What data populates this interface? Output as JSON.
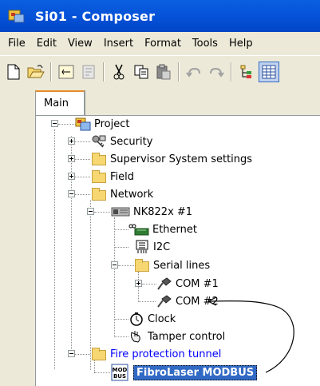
{
  "window": {
    "title": "Si01 - Composer"
  },
  "menu": [
    "File",
    "Edit",
    "View",
    "Insert",
    "Format",
    "Tools",
    "Help"
  ],
  "toolbar": {
    "buttons": [
      "new-icon",
      "open-icon",
      "properties-icon",
      "library-icon",
      "cut-icon",
      "copy-icon",
      "paste-icon",
      "undo-icon",
      "redo-icon",
      "tree-view-icon",
      "grid-view-icon"
    ]
  },
  "tabs": {
    "main": "Main"
  },
  "tree": {
    "project": "Project",
    "security": "Security",
    "supervisor": "Supervisor System settings",
    "field": "Field",
    "network": "Network",
    "nk822x": "NK822x #1",
    "ethernet": "Ethernet",
    "i2c": "I2C",
    "serial_lines": "Serial lines",
    "com1": "COM #1",
    "com2": "COM #2",
    "clock": "Clock",
    "tamper": "Tamper control",
    "fire_tunnel": "Fire protection tunnel",
    "fibrolaser": "FibroLaser MODBUS",
    "modbus_icon_text": "MOD BUS"
  },
  "colors": {
    "titlebar": "#0551d7",
    "selection": "#316ac5",
    "link_text": "#0000ff",
    "folder": "#f6d771"
  }
}
